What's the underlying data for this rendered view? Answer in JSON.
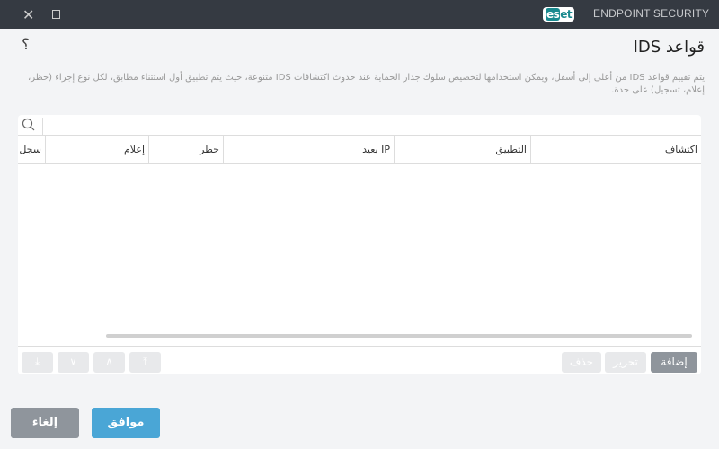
{
  "titlebar": {
    "close_icon": "close-icon",
    "maximize_icon": "maximize-icon",
    "logo_text": "eset",
    "product": "ENDPOINT SECURITY"
  },
  "page": {
    "title": "قواعد IDS",
    "help": "؟",
    "description": "يتم تقييم قواعد IDS من أعلى إلى أسفل، ويمكن استخدامها لتخصيص سلوك جدار الحماية عند حدوث اكتشافات IDS متنوعة، حيث يتم تطبيق أول استثناء مطابق، لكل نوع إجراء (حظر، إعلام، تسجيل) على حدة."
  },
  "table": {
    "columns": [
      "اكتشاف",
      "التطبيق",
      "IP بعيد",
      "حظر",
      "إعلام",
      "سجل"
    ],
    "rows": []
  },
  "toolbar": {
    "add": "إضافة",
    "edit": "تحرير",
    "delete": "حذف",
    "move_top": "⤒",
    "move_up": "∧",
    "move_down": "∨",
    "move_bottom": "⤓"
  },
  "footer": {
    "ok": "موافق",
    "cancel": "إلغاء"
  },
  "colors": {
    "titlebar": "#353a42",
    "accent": "#4aa6d6",
    "brand": "#1a8a8f",
    "secondary": "#8f959c"
  }
}
